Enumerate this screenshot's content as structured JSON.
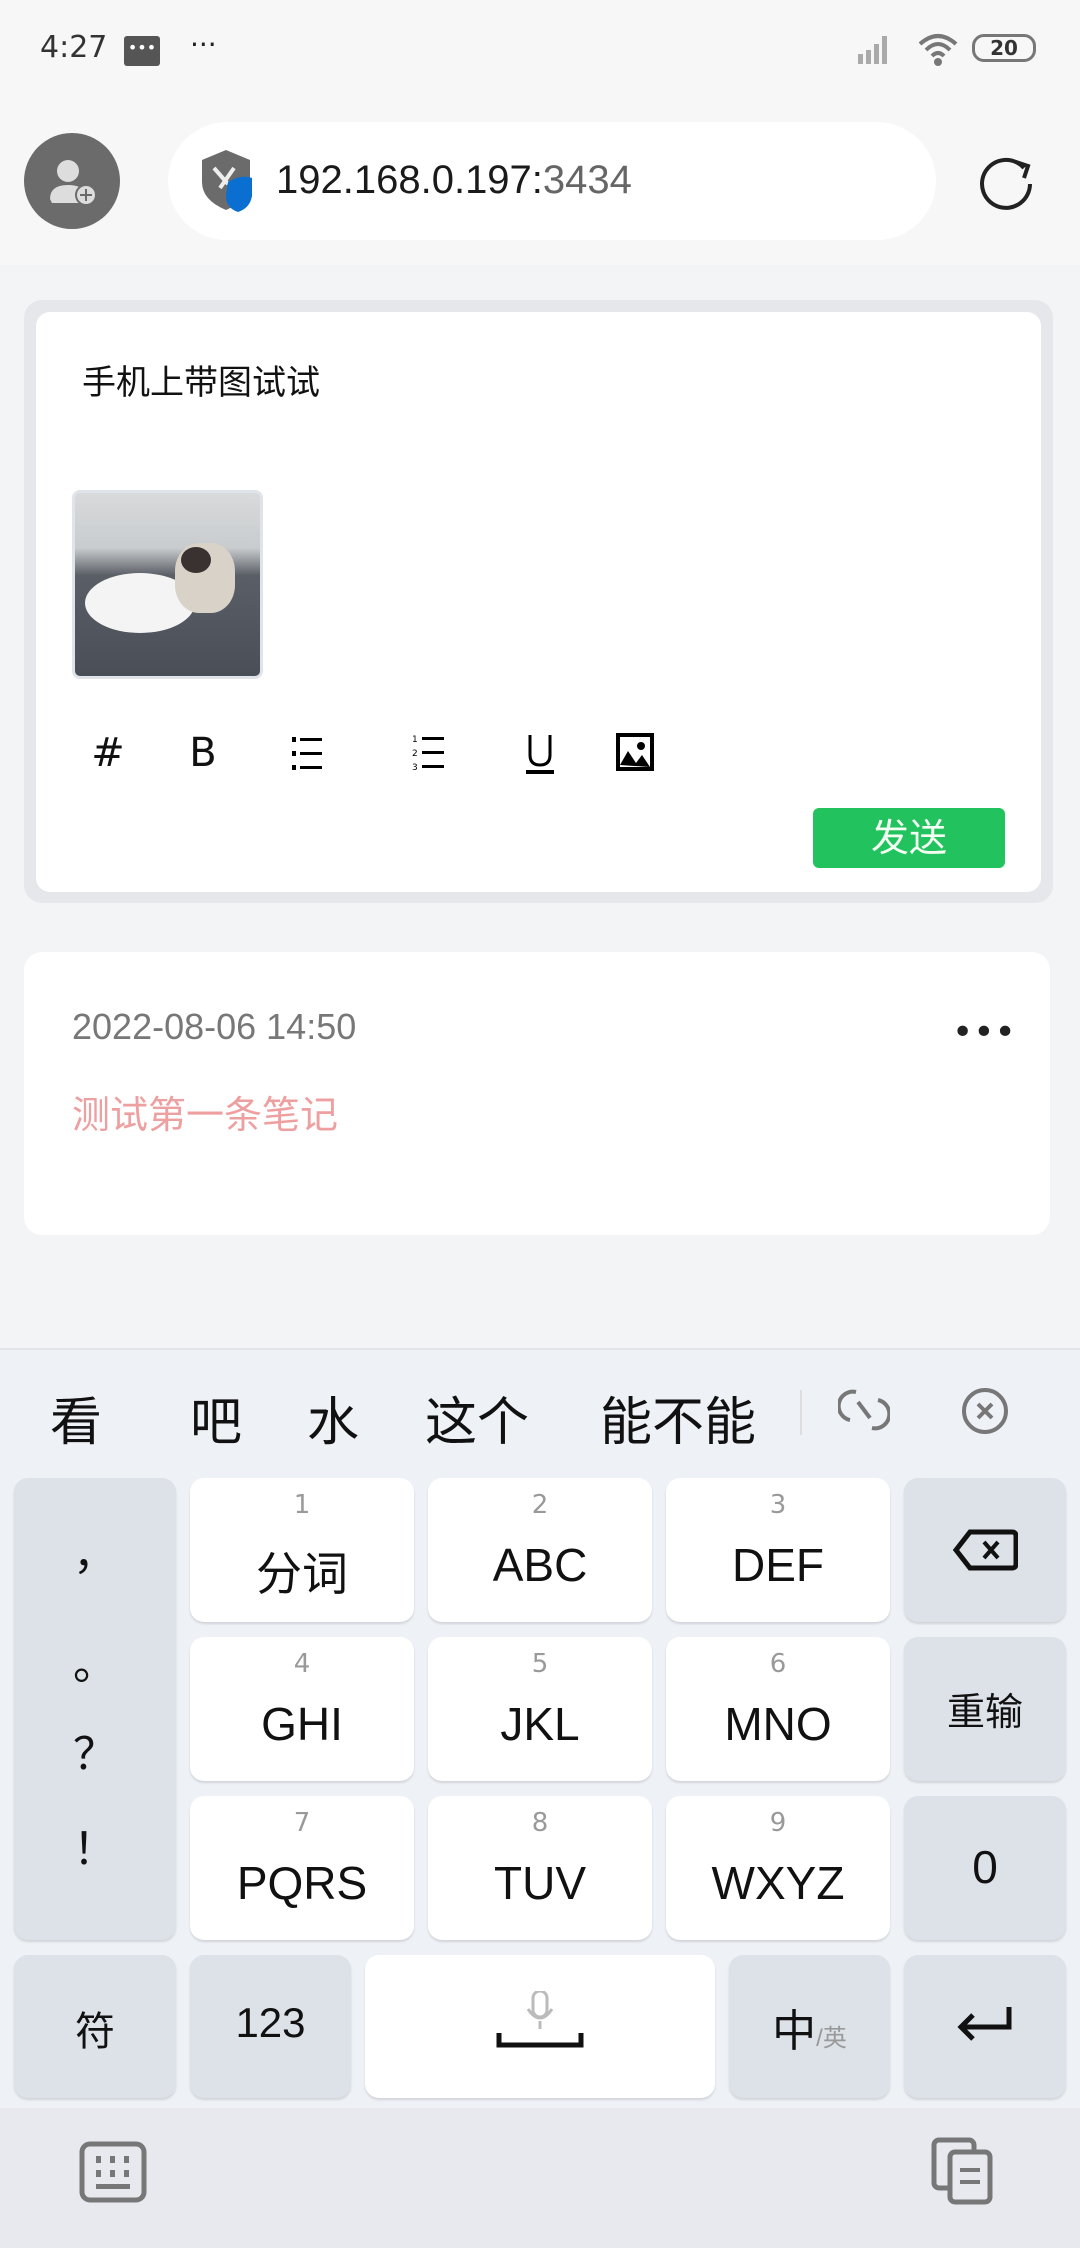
{
  "status_bar": {
    "time": "4:27",
    "battery": "20"
  },
  "browser": {
    "url_host": "192.168.0.197:",
    "url_port": "3434"
  },
  "editor": {
    "text": "手机上带图试试",
    "toolbar": [
      "#",
      "B"
    ],
    "send_label": "发送"
  },
  "notes": [
    {
      "date": "2022-08-06 14:50",
      "text": "测试第一条笔记",
      "color": "#ee9fa0"
    }
  ],
  "keyboard": {
    "candidates": [
      "看",
      "吧",
      "水",
      "这个",
      "能不能"
    ],
    "punct": [
      "，",
      "。",
      "？",
      "！"
    ],
    "keys": [
      {
        "num": "1",
        "label": "分词"
      },
      {
        "num": "2",
        "label": "ABC"
      },
      {
        "num": "3",
        "label": "DEF"
      },
      {
        "num": "4",
        "label": "GHI"
      },
      {
        "num": "5",
        "label": "JKL"
      },
      {
        "num": "6",
        "label": "MNO"
      },
      {
        "num": "7",
        "label": "PQRS"
      },
      {
        "num": "8",
        "label": "TUV"
      },
      {
        "num": "9",
        "label": "WXYZ"
      }
    ],
    "reinput": "重输",
    "zero": "0",
    "symbols": "符",
    "numbers": "123",
    "lang_main": "中",
    "lang_alt": "/英"
  },
  "colors": {
    "accent": "#22c35e",
    "shield": "#0a6fd1"
  }
}
